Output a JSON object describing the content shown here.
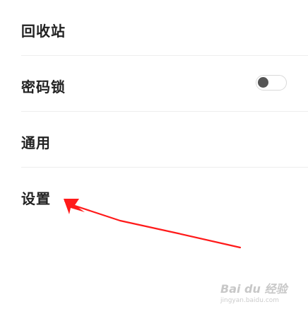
{
  "menu": {
    "items": [
      {
        "label": "回收站",
        "has_toggle": false
      },
      {
        "label": "密码锁",
        "has_toggle": true,
        "toggle_on": false
      },
      {
        "label": "通用",
        "has_toggle": false
      },
      {
        "label": "设置",
        "has_toggle": false
      }
    ]
  },
  "annotation": {
    "color": "#ff1a1a",
    "icon": "red-arrow"
  },
  "watermark": {
    "logo": "Bai du 经验",
    "url": "jingyan.baidu.com"
  }
}
